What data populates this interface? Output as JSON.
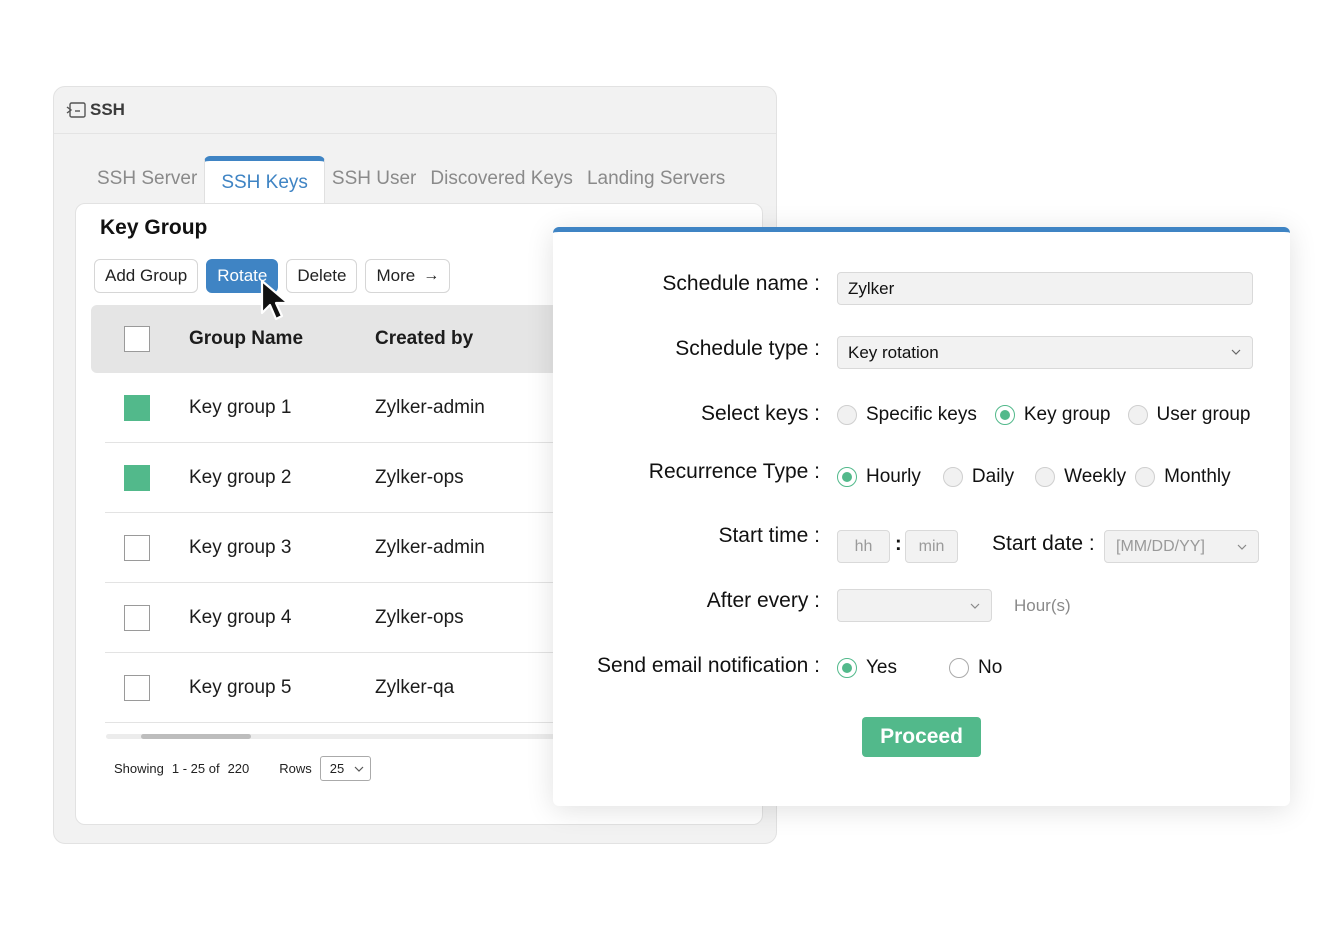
{
  "window": {
    "title": "SSH",
    "tabs": [
      {
        "label": "SSH Server"
      },
      {
        "label": "SSH Keys"
      },
      {
        "label": "SSH User"
      },
      {
        "label": "Discovered Keys"
      },
      {
        "label": "Landing Servers"
      }
    ]
  },
  "key_group": {
    "title": "Key Group",
    "toolbar": {
      "add_group": "Add Group",
      "rotate": "Rotate",
      "delete": "Delete",
      "more": "More"
    },
    "columns": [
      "Group Name",
      "Created by"
    ],
    "rows": [
      {
        "name": "Key group 1",
        "created_by": "Zylker-admin",
        "checked": true
      },
      {
        "name": "Key group 2",
        "created_by": "Zylker-ops",
        "checked": true
      },
      {
        "name": "Key group 3",
        "created_by": "Zylker-admin",
        "checked": false
      },
      {
        "name": "Key group 4",
        "created_by": "Zylker-ops",
        "checked": false
      },
      {
        "name": "Key group 5",
        "created_by": "Zylker-qa",
        "checked": false
      }
    ],
    "pager": {
      "showing_label": "Showing",
      "range": "1 - 25 of",
      "total": "220",
      "rows_label": "Rows",
      "rows_value": "25"
    }
  },
  "schedule": {
    "name_label": "Schedule name :",
    "name_value": "Zylker",
    "type_label": "Schedule type :",
    "type_value": "Key rotation",
    "select_keys_label": "Select keys :",
    "select_keys_options": [
      "Specific keys",
      "Key group",
      "User group"
    ],
    "select_keys_selected": "Key group",
    "recurrence_label": "Recurrence Type :",
    "recurrence_options": [
      "Hourly",
      "Daily",
      "Weekly",
      "Monthly"
    ],
    "recurrence_selected": "Hourly",
    "start_time_label": "Start time :",
    "hh_placeholder": "hh",
    "min_placeholder": "min",
    "time_separator": ":",
    "start_date_label": "Start date :",
    "start_date_placeholder": "[MM/DD/YY]",
    "after_every_label": "After every :",
    "after_every_value": "",
    "after_every_unit": "Hour(s)",
    "email_label": "Send email notification :",
    "email_options": [
      "Yes",
      "No"
    ],
    "email_selected": "Yes",
    "proceed": "Proceed"
  },
  "colors": {
    "accent_blue": "#3f84c4",
    "accent_green": "#52b98b"
  }
}
